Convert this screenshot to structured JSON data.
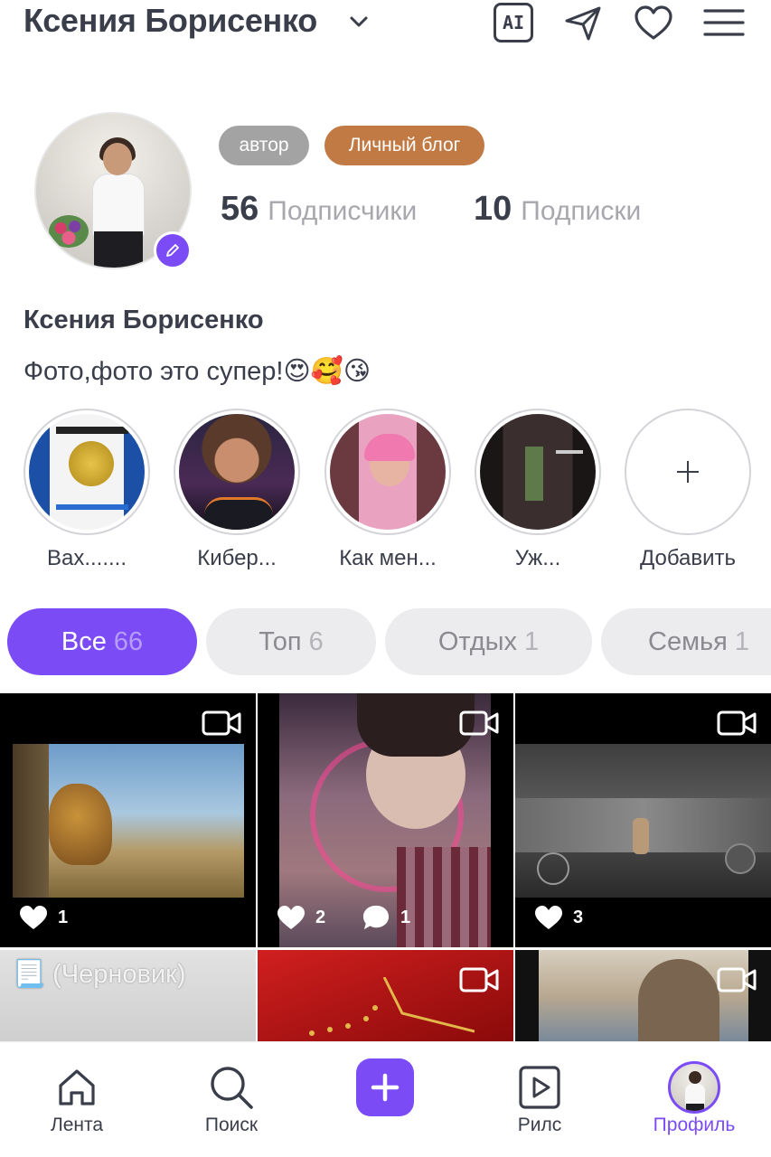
{
  "header": {
    "profile_name": "Ксения Борисенко",
    "ai_label": "AI"
  },
  "profile": {
    "tags": [
      "автор",
      "Личный блог"
    ],
    "followers_count": "56",
    "followers_label": "Подписчики",
    "following_count": "10",
    "following_label": "Подписки",
    "display_name": "Ксения Борисенко",
    "bio": "Фото,фото это супер!😍🥰😘"
  },
  "highlights": [
    {
      "label": "Вах......."
    },
    {
      "label": "Кибер..."
    },
    {
      "label": "Как мен..."
    },
    {
      "label": "Уж..."
    },
    {
      "label": "Добавить"
    }
  ],
  "chips": [
    {
      "label": "Все",
      "count": "66"
    },
    {
      "label": "Топ",
      "count": "6"
    },
    {
      "label": "Отдых",
      "count": "1"
    },
    {
      "label": "Семья",
      "count": "1"
    }
  ],
  "posts": [
    {
      "likes": "1"
    },
    {
      "likes": "2",
      "comments": "1"
    },
    {
      "likes": "3"
    },
    {
      "draft_label": "📃 (Черновик)"
    }
  ],
  "nav": {
    "feed": "Лента",
    "search": "Поиск",
    "reels": "Рилс",
    "profile": "Профиль"
  },
  "colors": {
    "accent": "#7b4cf5",
    "tag_author": "#a3a3a3",
    "tag_blog": "#c17a43"
  }
}
